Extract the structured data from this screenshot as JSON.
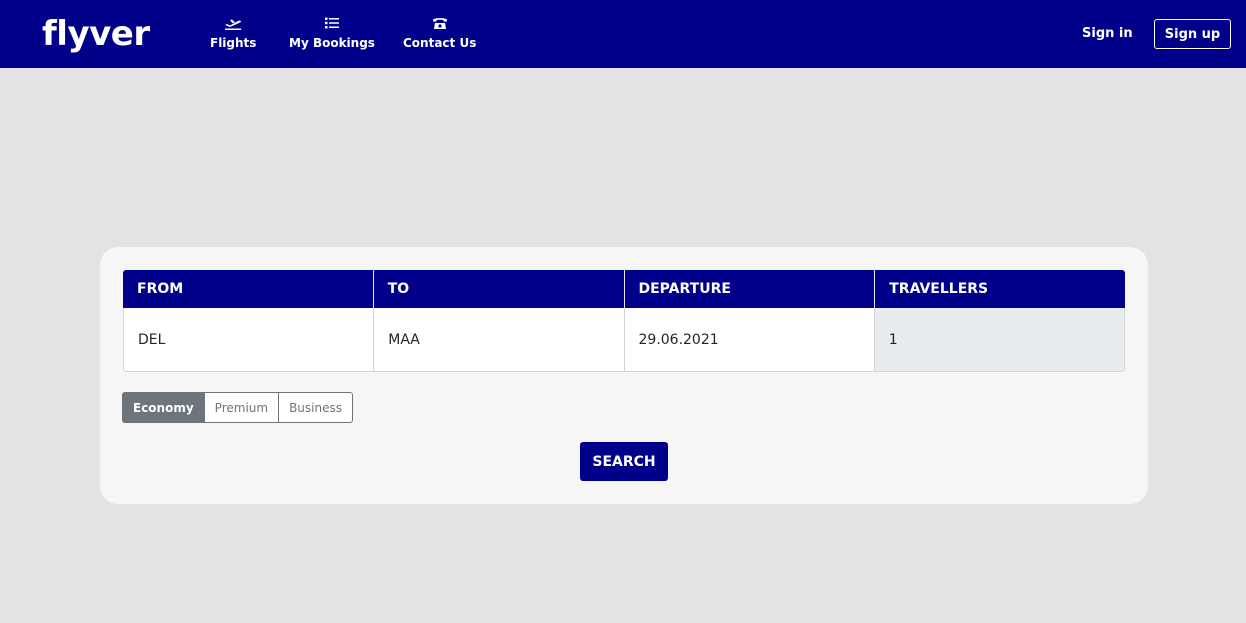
{
  "header": {
    "brand": "flyver",
    "nav": [
      {
        "label": "Flights",
        "icon": "plane-icon"
      },
      {
        "label": "My Bookings",
        "icon": "list-icon"
      },
      {
        "label": "Contact Us",
        "icon": "phone-icon"
      }
    ],
    "sign_in": "Sign in",
    "sign_up": "Sign up"
  },
  "search": {
    "columns": [
      "FROM",
      "TO",
      "DEPARTURE",
      "TRAVELLERS"
    ],
    "values": {
      "from": "DEL",
      "to": "MAA",
      "departure": "29.06.2021",
      "travellers": "1"
    },
    "cabin_classes": [
      "Economy",
      "Premium",
      "Business"
    ],
    "selected_cabin": "Economy",
    "search_label": "SEARCH"
  },
  "colors": {
    "brand": "#00008b",
    "background": "#e3e3e4",
    "card": "#f6f6f6",
    "selected_cabin": "#6c757d"
  }
}
